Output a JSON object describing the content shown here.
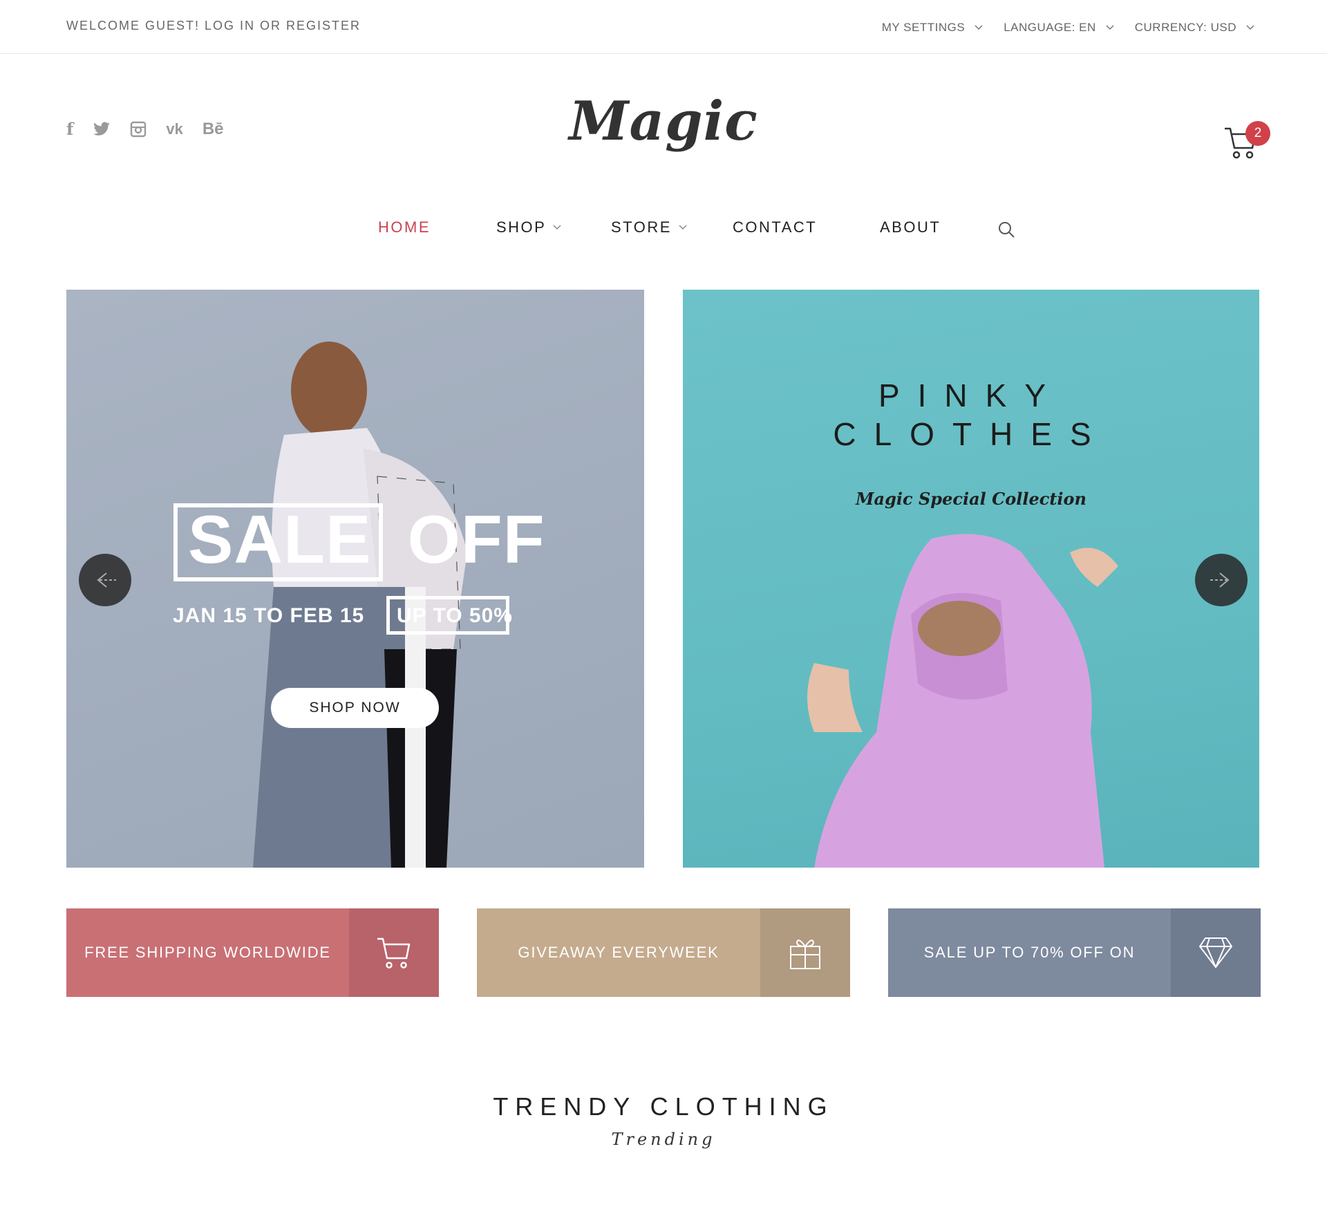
{
  "topbar": {
    "welcome": "WELCOME GUEST! LOG IN OR REGISTER",
    "settings": "MY SETTINGS",
    "language": "LANGUAGE: EN",
    "currency": "CURRENCY: USD"
  },
  "social": [
    "facebook-icon",
    "twitter-icon",
    "instagram-icon",
    "vk-icon",
    "behance-icon"
  ],
  "social_glyphs": {
    "facebook": "f",
    "vk": "vk",
    "behance": "Bē"
  },
  "logo": "Magic",
  "cart": {
    "count": "2"
  },
  "nav": {
    "home": "HOME",
    "shop": "SHOP",
    "store": "STORE",
    "contact": "CONTACT",
    "about": "ABOUT"
  },
  "hero_left": {
    "sale": "SALE",
    "off": "OFF",
    "dates": "JAN 15 TO FEB 15",
    "upto": "UP TO 50%",
    "cta": "SHOP NOW"
  },
  "hero_right": {
    "line1": "PINKY",
    "line2": "CLOTHES",
    "tagline": "Magic Special Collection"
  },
  "promos": [
    {
      "label": "FREE SHIPPING WORLDWIDE",
      "icon": "cart-icon",
      "color": "#c97075",
      "icon_bg": "#b8626a"
    },
    {
      "label": "GIVEAWAY EVERYWEEK",
      "icon": "gift-icon",
      "color": "#c4ab8e",
      "icon_bg": "#b09a80"
    },
    {
      "label": "SALE UP TO 70% OFF ON",
      "icon": "diamond-icon",
      "color": "#7e8a9e",
      "icon_bg": "#6f7b8f"
    }
  ],
  "section": {
    "title": "TRENDY CLOTHING",
    "subtitle": "Trending"
  },
  "colors": {
    "accent": "#c94350",
    "badge": "#d0414a"
  }
}
